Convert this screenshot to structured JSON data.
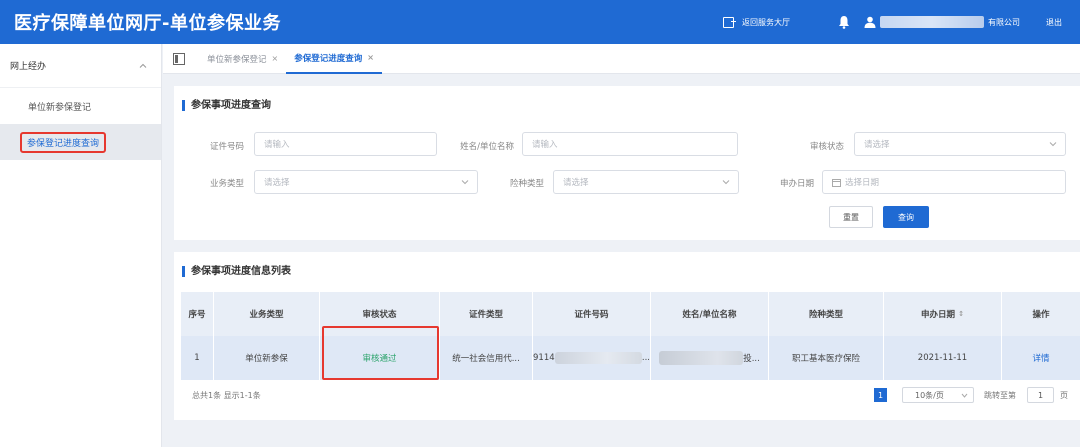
{
  "header": {
    "title": "医疗保障单位网厅-单位参保业务",
    "return_hall": "返回服务大厅",
    "user_suffix": "有限公司",
    "logout": "退出"
  },
  "sidebar": {
    "group_label": "网上经办",
    "items": [
      {
        "label": "单位新参保登记"
      },
      {
        "label": "参保登记进度查询"
      }
    ]
  },
  "tabs": [
    {
      "label": "单位新参保登记",
      "close": "×"
    },
    {
      "label": "参保登记进度查询",
      "close": "×"
    }
  ],
  "query": {
    "title": "参保事项进度查询",
    "fields": {
      "id_no": {
        "label": "证件号码",
        "placeholder": "请输入"
      },
      "name": {
        "label": "姓名/单位名称",
        "placeholder": "请输入"
      },
      "audit_status": {
        "label": "审核状态",
        "placeholder": "请选择"
      },
      "biz_type": {
        "label": "业务类型",
        "placeholder": "请选择"
      },
      "insurance_type": {
        "label": "险种类型",
        "placeholder": "请选择"
      },
      "apply_date": {
        "label": "申办日期",
        "placeholder": "选择日期"
      }
    },
    "reset_label": "重置",
    "query_label": "查询"
  },
  "list": {
    "title": "参保事项进度信息列表",
    "columns": [
      "序号",
      "业务类型",
      "审核状态",
      "证件类型",
      "证件号码",
      "姓名/单位名称",
      "险种类型",
      "申办日期",
      "操作"
    ],
    "sort_mark": "↕",
    "rows": [
      {
        "index": "1",
        "biz_type": "单位新参保",
        "status": "审核通过",
        "id_type": "统一社会信用代...",
        "id_no_prefix": "9114",
        "id_no_suffix": "...",
        "name_suffix": "投...",
        "insurance_type": "职工基本医疗保险",
        "apply_date": "2021-11-11",
        "action": "详情"
      }
    ],
    "pagination": {
      "summary": "总共1条 显示1-1条",
      "current_page": "1",
      "page_size": "10条/页",
      "jump_label": "跳转至第",
      "jump_value": "1",
      "jump_unit": "页"
    }
  },
  "colors": {
    "primary": "#1f6ad3",
    "highlight": "#e6382f",
    "success": "#2ba36b"
  }
}
